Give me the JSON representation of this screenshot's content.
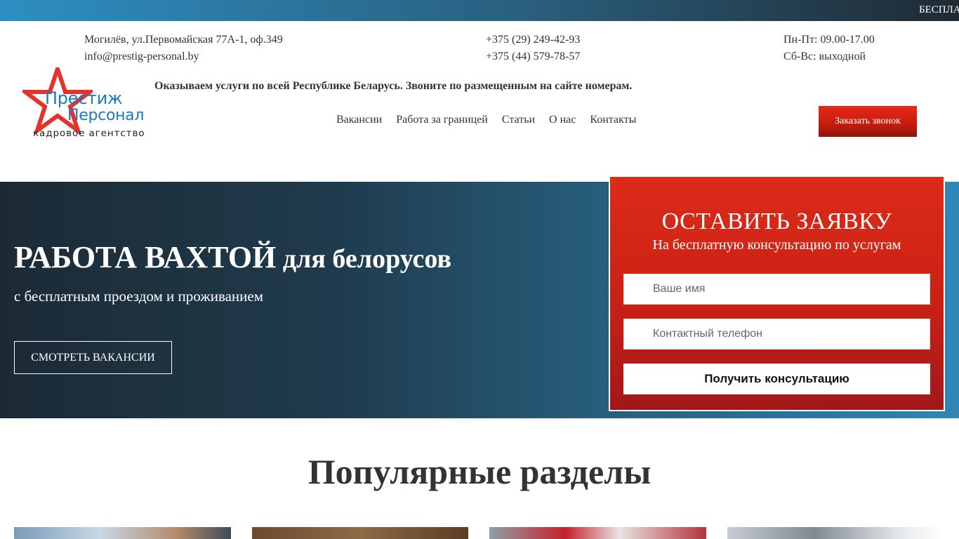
{
  "topbar": {
    "ticker": "БЕСПЛА"
  },
  "contacts": {
    "address": "Могилёв, ул.Первомайская 77А-1, оф.349",
    "email": "info@prestig-personal.by",
    "phone1": "+375 (29) 249-42-93",
    "phone2": "+375 (44) 579-78-57",
    "hours_weekdays": "Пн-Пт: 09.00-17.00",
    "hours_weekend": "Сб-Вс: выходной"
  },
  "logo": {
    "line1": "Престиж",
    "line2": "Персонал",
    "line3": "кадровое агентство"
  },
  "slogan": "Оказываем услуги по всей Республике Беларусь. Звоните по размещенным на сайте номерам.",
  "nav": {
    "items": [
      {
        "label": "Вакансии"
      },
      {
        "label": "Работа за границей"
      },
      {
        "label": "Статьи"
      },
      {
        "label": "О нас"
      },
      {
        "label": "Контакты"
      }
    ],
    "callback_button": "Заказать звонок"
  },
  "hero": {
    "title_bold": "РАБОТА ВАХТОЙ",
    "title_rest": " для белорусов",
    "subtitle": "с бесплатным проездом и проживанием",
    "button": "СМОТРЕТЬ ВАКАНСИИ"
  },
  "form": {
    "title": "ОСТАВИТЬ ЗАЯВКУ",
    "subtitle": "На бесплатную консультацию по услугам",
    "name_placeholder": "Ваше имя",
    "phone_placeholder": "Контактный телефон",
    "submit": "Получить консультацию"
  },
  "popular": {
    "title": "Популярные разделы"
  },
  "colors": {
    "accent_red": "#d42617",
    "brand_blue": "#1d78be",
    "hero_dark": "#1c2a35"
  }
}
